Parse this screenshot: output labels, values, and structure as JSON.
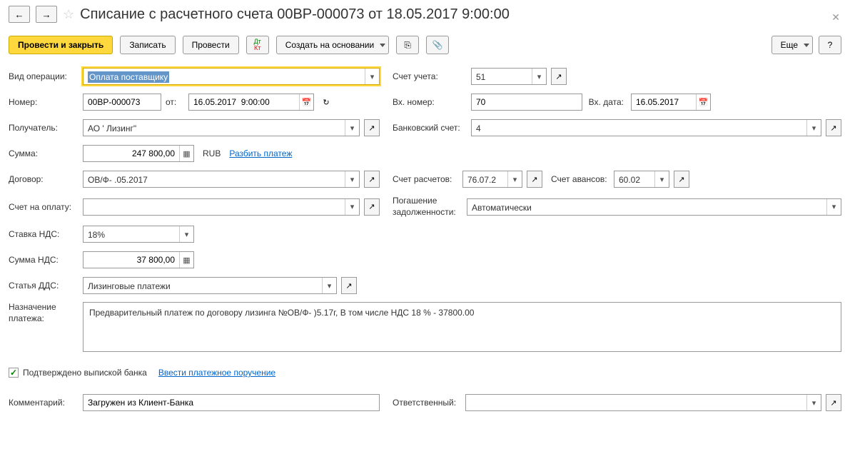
{
  "title": "Списание с расчетного счета 00ВР-000073 от 18.05.2017 9:00:00",
  "toolbar": {
    "post_close": "Провести и закрыть",
    "save": "Записать",
    "post": "Провести",
    "create_based": "Создать на основании",
    "more": "Еще",
    "help": "?"
  },
  "labels": {
    "operation_type": "Вид операции:",
    "account": "Счет учета:",
    "number": "Номер:",
    "from": "от:",
    "inc_number": "Вх. номер:",
    "inc_date": "Вх. дата:",
    "recipient": "Получатель:",
    "bank_account": "Банковский счет:",
    "amount": "Сумма:",
    "split": "Разбить платеж",
    "contract": "Договор:",
    "settlement_acc": "Счет расчетов:",
    "advance_acc": "Счет авансов:",
    "invoice": "Счет на оплату:",
    "debt": "Погашение задолженности:",
    "vat_rate": "Ставка НДС:",
    "vat_sum": "Сумма НДС:",
    "dds": "Статья ДДС:",
    "purpose": "Назначение платежа:",
    "confirmed": "Подтверждено выпиской банка",
    "enter_payment": "Ввести платежное поручение",
    "comment": "Комментарий:",
    "responsible": "Ответственный:"
  },
  "values": {
    "operation_type": "Оплата поставщику",
    "account": "51",
    "number": "00ВР-000073",
    "date": "16.05.2017  9:00:00",
    "inc_number": "70",
    "inc_date": "16.05.2017",
    "recipient": "АО '            Лизинг\"",
    "bank_account": "4",
    "amount": "247 800,00",
    "currency": "RUB",
    "contract": "ОВ/Ф-                     .05.2017",
    "settlement_acc": "76.07.2",
    "advance_acc": "60.02",
    "debt": "Автоматически",
    "vat_rate": "18%",
    "vat_sum": "37 800,00",
    "dds": "Лизинговые платежи",
    "purpose": "Предварительный платеж по договору лизинга №ОВ/Ф-                             )5.17г,  В том числе НДС 18 % - 37800.00",
    "comment": "Загружен из Клиент-Банка",
    "responsible": ""
  }
}
